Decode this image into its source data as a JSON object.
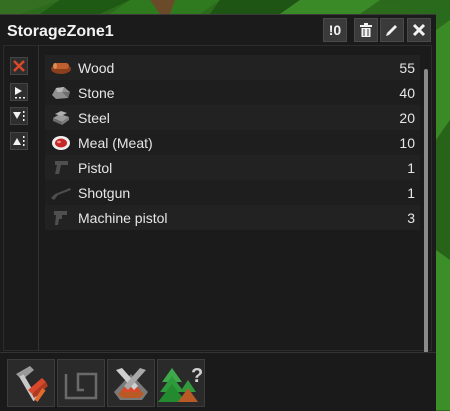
{
  "window": {
    "title": "StorageZone1",
    "forbid_button_label": "!0"
  },
  "items": [
    {
      "name": "Wood",
      "count": "55",
      "icon": "wood-icon"
    },
    {
      "name": "Stone",
      "count": "40",
      "icon": "stone-icon"
    },
    {
      "name": "Steel",
      "count": "20",
      "icon": "steel-icon"
    },
    {
      "name": "Meal (Meat)",
      "count": "10",
      "icon": "meal-icon"
    },
    {
      "name": "Pistol",
      "count": "1",
      "icon": "pistol-icon"
    },
    {
      "name": "Shotgun",
      "count": "1",
      "icon": "shotgun-icon"
    },
    {
      "name": "Machine pistol",
      "count": "3",
      "icon": "machine-pistol-icon"
    }
  ],
  "sidebar_buttons": [
    "clear-filter-icon",
    "drop-icon",
    "sort-descending-icon",
    "sort-ascending-icon"
  ],
  "toolbar": [
    "build-hammer-icon",
    "zone-outline-icon",
    "deconstruct-icon",
    "plant-unknown-icon"
  ],
  "colors": {
    "panel": "#1b1b1b",
    "accent_red": "#d9482b",
    "wood": "#b4562a"
  }
}
